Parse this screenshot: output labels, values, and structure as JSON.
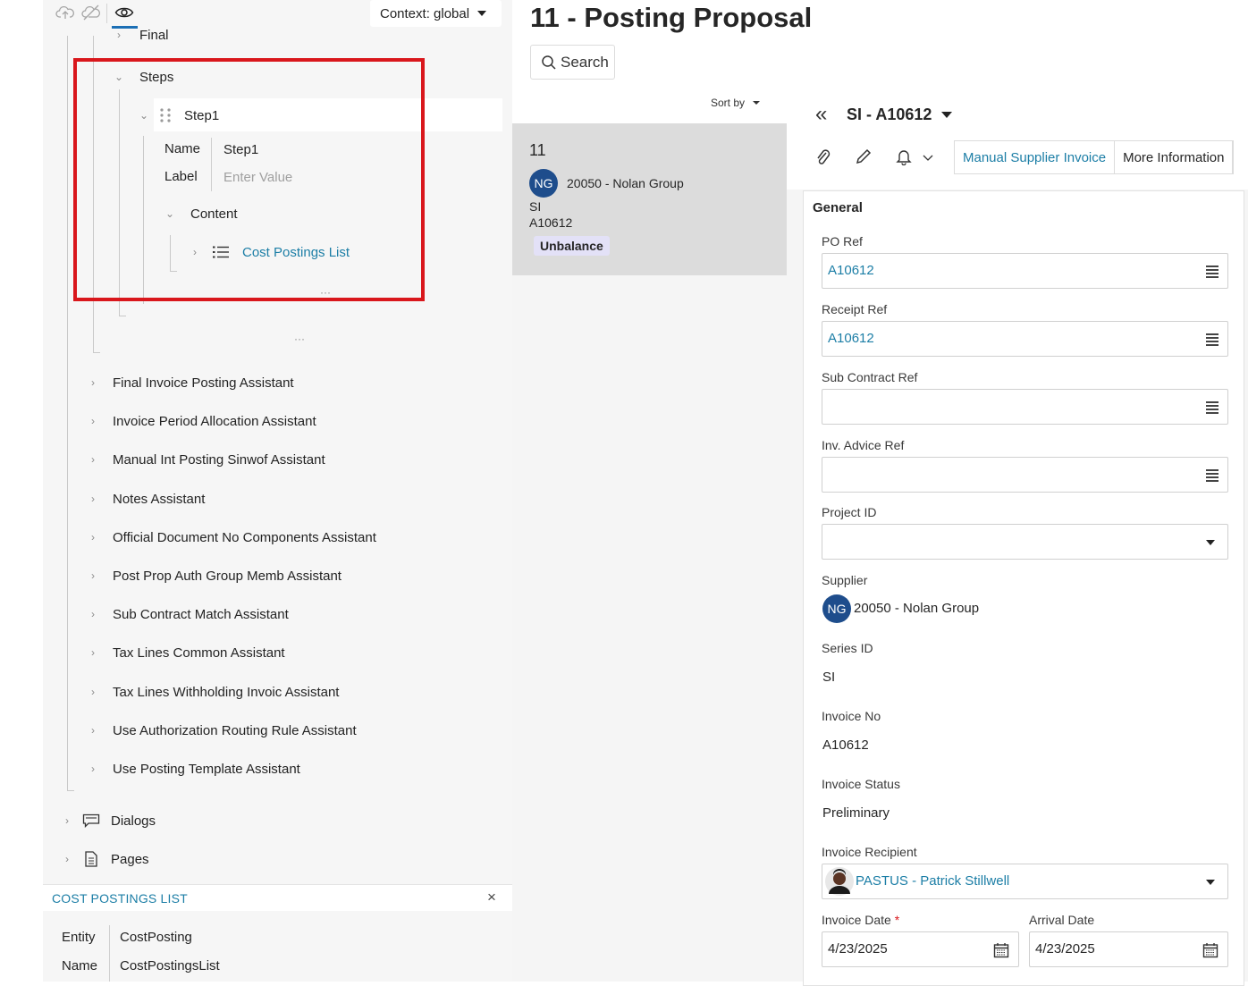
{
  "designer": {
    "toolbar": {
      "context_label": "Context: global"
    },
    "tree_top_partial": "Final",
    "steps_label": "Steps",
    "step1_label": "Step1",
    "step_props": {
      "name_label": "Name",
      "name_value": "Step1",
      "label_label": "Label",
      "label_placeholder": "Enter Value"
    },
    "content_label": "Content",
    "cost_postings_list": "Cost Postings List",
    "assistants": [
      "Final Invoice Posting Assistant",
      "Invoice Period Allocation Assistant",
      "Manual Int Posting Sinwof Assistant",
      "Notes Assistant",
      "Official Document No Components Assistant",
      "Post Prop Auth Group Memb Assistant",
      "Sub Contract Match Assistant",
      "Tax Lines Common Assistant",
      "Tax Lines Withholding Invoic Assistant",
      "Use Authorization Routing Rule Assistant",
      "Use Posting Template Assistant"
    ],
    "dialogs_label": "Dialogs",
    "pages_label": "Pages",
    "props_panel": {
      "title": "COST POSTINGS LIST",
      "entity_label": "Entity",
      "entity_value": "CostPosting",
      "name_label": "Name",
      "name_value": "CostPostingsList"
    }
  },
  "page": {
    "title": "11 - Posting Proposal",
    "search_label": "Search"
  },
  "list": {
    "sort_label": "Sort by",
    "card": {
      "number": "11",
      "avatar_initials": "NG",
      "supplier": "20050 - Nolan Group",
      "series": "SI",
      "invoice": "A10612",
      "badge": "Unbalance"
    }
  },
  "detail": {
    "record_title": "SI - A10612",
    "tabs": [
      "Manual Supplier Invoice",
      "More Information"
    ],
    "section_title": "General",
    "po_ref_label": "PO Ref",
    "po_ref_value": "A10612",
    "receipt_ref_label": "Receipt Ref",
    "receipt_ref_value": "A10612",
    "sub_contract_ref_label": "Sub Contract Ref",
    "inv_advice_ref_label": "Inv. Advice Ref",
    "project_id_label": "Project ID",
    "supplier_label": "Supplier",
    "supplier_initials": "NG",
    "supplier_value": "20050 - Nolan Group",
    "series_id_label": "Series ID",
    "series_id_value": "SI",
    "invoice_no_label": "Invoice No",
    "invoice_no_value": "A10612",
    "invoice_status_label": "Invoice Status",
    "invoice_status_value": "Preliminary",
    "invoice_recipient_label": "Invoice Recipient",
    "invoice_recipient_value": "PASTUS - Patrick Stillwell",
    "invoice_date_label": "Invoice Date",
    "required_mark": "*",
    "invoice_date_value": "4/23/2025",
    "arrival_date_label": "Arrival Date",
    "arrival_date_value": "4/23/2025"
  },
  "colors": {
    "highlight_box": "#d9171c",
    "link": "#1c7ea6",
    "avatar": "#1e4d8c",
    "badge_bg": "#e3e1f7"
  }
}
